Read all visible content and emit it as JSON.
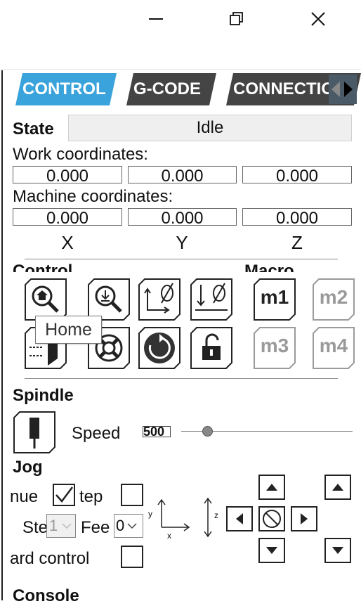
{
  "window": {
    "minimize_icon": "minimize-icon",
    "restore_icon": "restore-icon",
    "close_icon": "close-icon"
  },
  "tabs": [
    {
      "label": "CONTROL",
      "active": true
    },
    {
      "label": "G-CODE",
      "active": false
    },
    {
      "label": "CONNECTION",
      "active": false
    }
  ],
  "state": {
    "label": "State",
    "value": "Idle"
  },
  "work_coords": {
    "label": "Work coordinates:",
    "x": "0.000",
    "y": "0.000",
    "z": "0.000"
  },
  "machine_coords": {
    "label": "Machine coordinates:",
    "x": "0.000",
    "y": "0.000",
    "z": "0.000"
  },
  "axes": {
    "x": "X",
    "y": "Y",
    "z": "Z"
  },
  "control": {
    "label": "Control",
    "tooltip": "Home"
  },
  "macro": {
    "label": "Macro",
    "m1": "m1",
    "m2": "m2",
    "m3": "m3",
    "m4": "m4"
  },
  "spindle": {
    "label": "Spindle",
    "speed_label": "Speed",
    "speed_value": "500"
  },
  "jog": {
    "label": "Jog",
    "continue_label": "nue",
    "step_label": "tep",
    "step_size_label": "Ste",
    "step_size_value": "1",
    "feed_label": "Fee",
    "feed_value": "0",
    "keyboard_label": "ard control",
    "axis_y": "y",
    "axis_x": "x",
    "axis_z": "z"
  },
  "console": {
    "label": "Console"
  },
  "colors": {
    "tab_active": "#3aa3db",
    "tab_inactive": "#444444",
    "disabled": "#9a9a9a"
  }
}
